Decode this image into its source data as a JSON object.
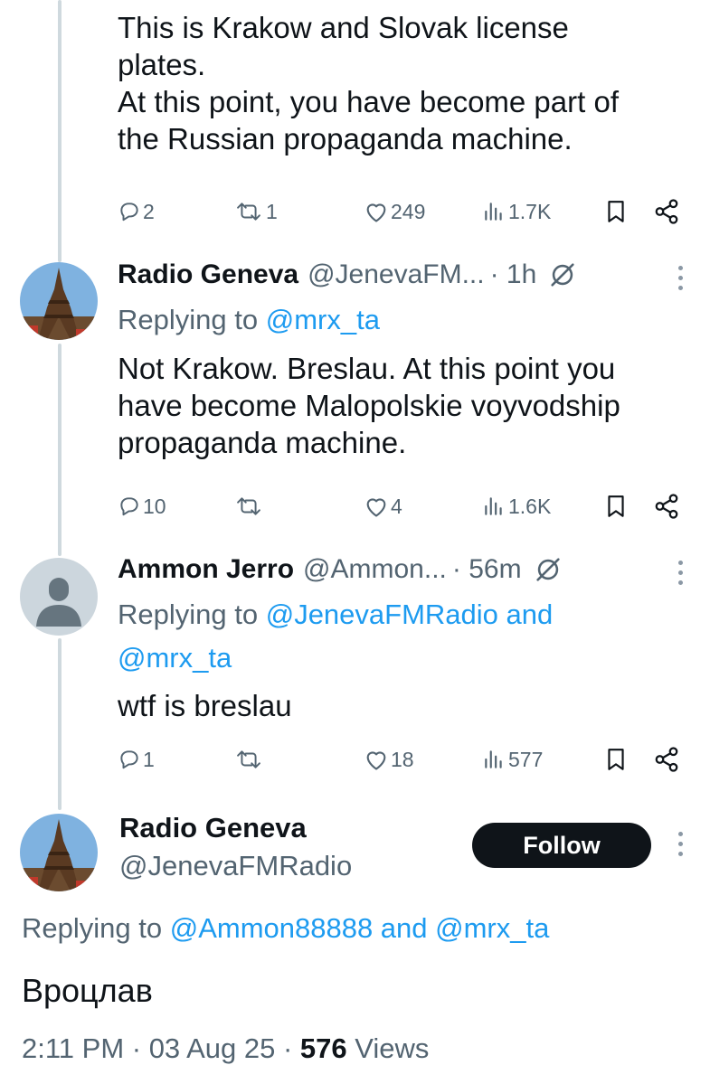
{
  "tweet1": {
    "text": "This is Krakow and Slovak license\nplates.\nAt this point, you have become part of\nthe Russian propaganda machine.",
    "replies": "2",
    "retweets": "1",
    "likes": "249",
    "views": "1.7K"
  },
  "tweet2": {
    "name": "Radio Geneva",
    "handle": "@JenevaFM...",
    "time": "· 1h",
    "replying_prefix": "Replying to ",
    "replying_to": "@mrx_ta",
    "text": "Not Krakow. Breslau. At this point you\nhave become Malopolskie voyvodship\npropaganda machine.",
    "replies": "10",
    "retweets": "",
    "likes": "4",
    "views": "1.6K"
  },
  "tweet3": {
    "name": "Ammon Jerro",
    "handle": "@Ammon...",
    "time": "· 56m",
    "replying_prefix": "Replying to ",
    "replying_line1": "@JenevaFMRadio and",
    "replying_line2": "@mrx_ta",
    "text": "wtf is breslau",
    "replies": "1",
    "retweets": "",
    "likes": "18",
    "views": "577"
  },
  "main": {
    "name": "Radio Geneva",
    "handle": "@JenevaFMRadio",
    "follow_label": "Follow",
    "replying_prefix": "Replying to ",
    "replying_to": "@Ammon88888 and @mrx_ta",
    "text": "Вроцлав",
    "time": "2:11 PM · 03 Aug 25 · ",
    "views_count": "576",
    "views_label": " Views"
  },
  "colors": {
    "accent": "#1d9bf0",
    "muted": "#536471",
    "text": "#0f1419",
    "thread_line": "#cfd9de"
  },
  "icons": [
    "reply-icon",
    "retweet-icon",
    "like-icon",
    "views-icon",
    "bookmark-icon",
    "share-icon",
    "grok-icon",
    "more-icon"
  ]
}
